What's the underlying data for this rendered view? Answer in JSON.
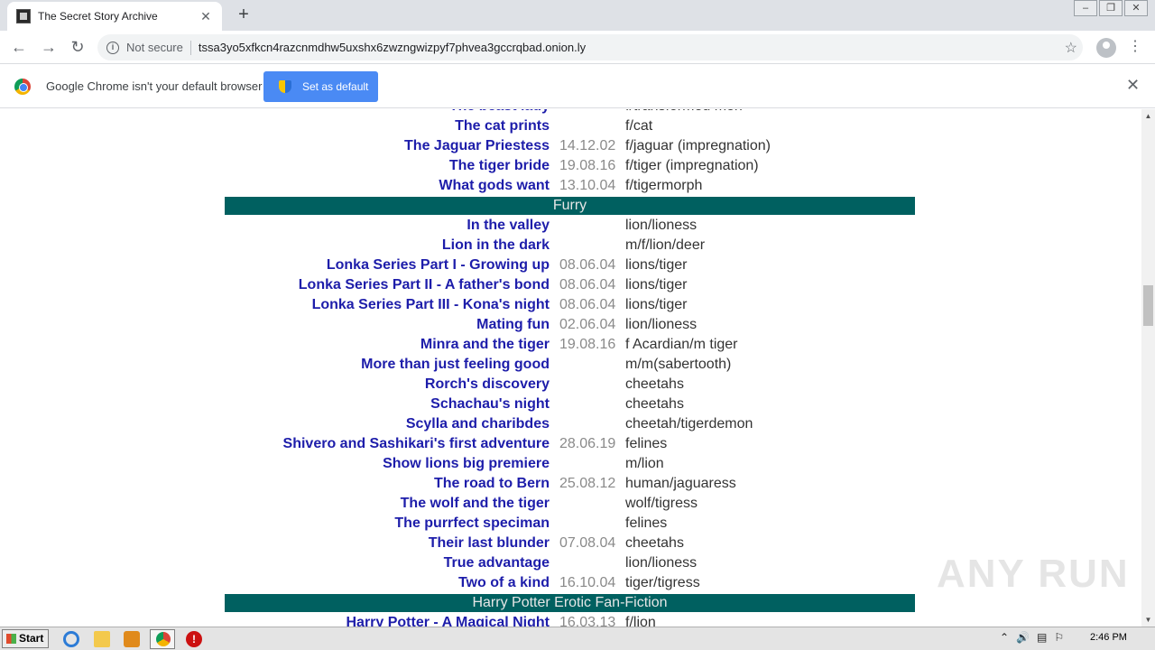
{
  "browser": {
    "tab_title": "The Secret Story Archive",
    "tab_close": "✕",
    "new_tab": "+",
    "not_secure": "Not secure",
    "url": "tssa3yo5xfkcn4razcnmdhw5uxshx6zwzngwizpyf7phvea3gccrqbad.onion.ly",
    "window_controls": [
      "–",
      "❐",
      "✕"
    ]
  },
  "infobar": {
    "message": "Google Chrome isn't your default browser",
    "button": "Set as default",
    "close": "✕"
  },
  "stories": [
    {
      "title": "The beast lady",
      "date": "",
      "tags": "f/transformed men"
    },
    {
      "title": "The cat prints",
      "date": "",
      "tags": "f/cat"
    },
    {
      "title": "The Jaguar Priestess",
      "date": "14.12.02",
      "tags": "f/jaguar (impregnation)"
    },
    {
      "title": "The tiger bride",
      "date": "19.08.16",
      "tags": "f/tiger (impregnation)"
    },
    {
      "title": "What gods want",
      "date": "13.10.04",
      "tags": "f/tigermorph"
    }
  ],
  "section_furry": "Furry",
  "furry": [
    {
      "title": "In the valley",
      "date": "",
      "tags": "lion/lioness"
    },
    {
      "title": "Lion in the dark",
      "date": "",
      "tags": "m/f/lion/deer"
    },
    {
      "title": "Lonka Series Part I - Growing up",
      "date": "08.06.04",
      "tags": "lions/tiger"
    },
    {
      "title": "Lonka Series Part II - A father's bond",
      "date": "08.06.04",
      "tags": "lions/tiger"
    },
    {
      "title": "Lonka Series Part III - Kona's night",
      "date": "08.06.04",
      "tags": "lions/tiger"
    },
    {
      "title": "Mating fun",
      "date": "02.06.04",
      "tags": "lion/lioness"
    },
    {
      "title": "Minra and the tiger",
      "date": "19.08.16",
      "tags": "f Acardian/m tiger"
    },
    {
      "title": "More than just feeling good",
      "date": "",
      "tags": "m/m(sabertooth)"
    },
    {
      "title": "Rorch's discovery",
      "date": "",
      "tags": "cheetahs"
    },
    {
      "title": "Schachau's night",
      "date": "",
      "tags": "cheetahs"
    },
    {
      "title": "Scylla and charibdes",
      "date": "",
      "tags": "cheetah/tigerdemon"
    },
    {
      "title": "Shivero and Sashikari's first adventure",
      "date": "28.06.19",
      "tags": "felines"
    },
    {
      "title": "Show lions big premiere",
      "date": "",
      "tags": "m/lion"
    },
    {
      "title": "The road to Bern",
      "date": "25.08.12",
      "tags": "human/jaguaress"
    },
    {
      "title": "The wolf and the tiger",
      "date": "",
      "tags": "wolf/tigress"
    },
    {
      "title": "The purrfect speciman",
      "date": "",
      "tags": "felines"
    },
    {
      "title": "Their last blunder",
      "date": "07.08.04",
      "tags": "cheetahs"
    },
    {
      "title": "True advantage",
      "date": "",
      "tags": "lion/lioness"
    },
    {
      "title": "Two of a kind",
      "date": "16.10.04",
      "tags": "tiger/tigress"
    }
  ],
  "section_hp": "Harry Potter Erotic Fan-Fiction",
  "hp": [
    {
      "title": "Harry Potter - A Magical Night",
      "date": "16.03.13",
      "tags": "f/lion"
    }
  ],
  "watermark": "ANY RUN",
  "taskbar": {
    "start": "Start",
    "clock": "2:46 PM",
    "tray_icons": [
      "⌃",
      "🔊",
      "▤",
      "⚐"
    ]
  }
}
